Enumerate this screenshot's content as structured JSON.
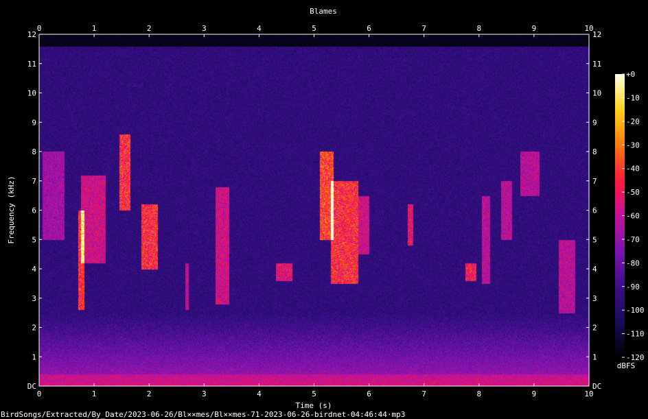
{
  "page": {
    "title": "Blames",
    "footer_path": "BirdSongs/Extracted/By_Date/2023-06-26/Bl××mes/Bl××mes-71-2023-06-26-birdnet-04:46:44·mp3"
  },
  "chart_data": {
    "type": "heatmap",
    "title": "Blames",
    "xlabel": "Time (s)",
    "ylabel": "Frequency (kHz)",
    "xlim": [
      0,
      10
    ],
    "ylim": [
      0,
      12
    ],
    "x_ticks": [
      "0",
      "1",
      "2",
      "3",
      "4",
      "5",
      "6",
      "7",
      "8",
      "9",
      "10"
    ],
    "y_ticks": [
      "DC",
      "1",
      "2",
      "3",
      "4",
      "5",
      "6",
      "7",
      "8",
      "9",
      "10",
      "11",
      "12"
    ],
    "colorbar": {
      "unit": "dBFS",
      "range": [
        -120,
        0
      ],
      "ticks": [
        "+0",
        "-10",
        "-20",
        "-30",
        "-40",
        "-50",
        "-60",
        "-70",
        "-80",
        "-90",
        "-100",
        "-110",
        "-120"
      ],
      "colors": [
        "#000000",
        "#1a0a5c",
        "#3b0f8a",
        "#7a14b0",
        "#c4129a",
        "#ff1a3c",
        "#ff7a10",
        "#ffd21a",
        "#ffffe8"
      ]
    },
    "background_level_dbfs": -95,
    "content_upper_khz": 11.6,
    "events": [
      {
        "t0": 0.05,
        "t1": 0.45,
        "f0": 5.0,
        "f1": 8.0,
        "level": 0.3
      },
      {
        "t0": 0.7,
        "t1": 0.82,
        "f0": 2.6,
        "f1": 6.0,
        "level": 0.55
      },
      {
        "t0": 0.75,
        "t1": 1.2,
        "f0": 4.2,
        "f1": 7.2,
        "level": 0.4
      },
      {
        "t0": 1.45,
        "t1": 1.65,
        "f0": 6.0,
        "f1": 8.6,
        "level": 0.55
      },
      {
        "t0": 1.85,
        "t1": 2.15,
        "f0": 4.0,
        "f1": 6.2,
        "level": 0.55
      },
      {
        "t0": 2.65,
        "t1": 2.72,
        "f0": 2.6,
        "f1": 4.2,
        "level": 0.35
      },
      {
        "t0": 3.2,
        "t1": 3.45,
        "f0": 2.8,
        "f1": 6.8,
        "level": 0.4
      },
      {
        "t0": 4.3,
        "t1": 4.6,
        "f0": 3.6,
        "f1": 4.2,
        "level": 0.45
      },
      {
        "t0": 5.1,
        "t1": 5.35,
        "f0": 5.0,
        "f1": 8.0,
        "level": 0.6
      },
      {
        "t0": 5.3,
        "t1": 5.8,
        "f0": 3.5,
        "f1": 7.0,
        "level": 0.55
      },
      {
        "t0": 5.8,
        "t1": 6.0,
        "f0": 4.5,
        "f1": 6.5,
        "level": 0.4
      },
      {
        "t0": 6.7,
        "t1": 6.8,
        "f0": 4.8,
        "f1": 6.2,
        "level": 0.45
      },
      {
        "t0": 7.75,
        "t1": 7.95,
        "f0": 3.6,
        "f1": 4.2,
        "level": 0.5
      },
      {
        "t0": 8.05,
        "t1": 8.2,
        "f0": 3.5,
        "f1": 6.5,
        "level": 0.35
      },
      {
        "t0": 8.4,
        "t1": 8.6,
        "f0": 5.0,
        "f1": 7.0,
        "level": 0.35
      },
      {
        "t0": 8.75,
        "t1": 9.1,
        "f0": 6.5,
        "f1": 8.0,
        "level": 0.35
      },
      {
        "t0": 9.45,
        "t1": 9.75,
        "f0": 2.5,
        "f1": 5.0,
        "level": 0.35
      }
    ]
  }
}
